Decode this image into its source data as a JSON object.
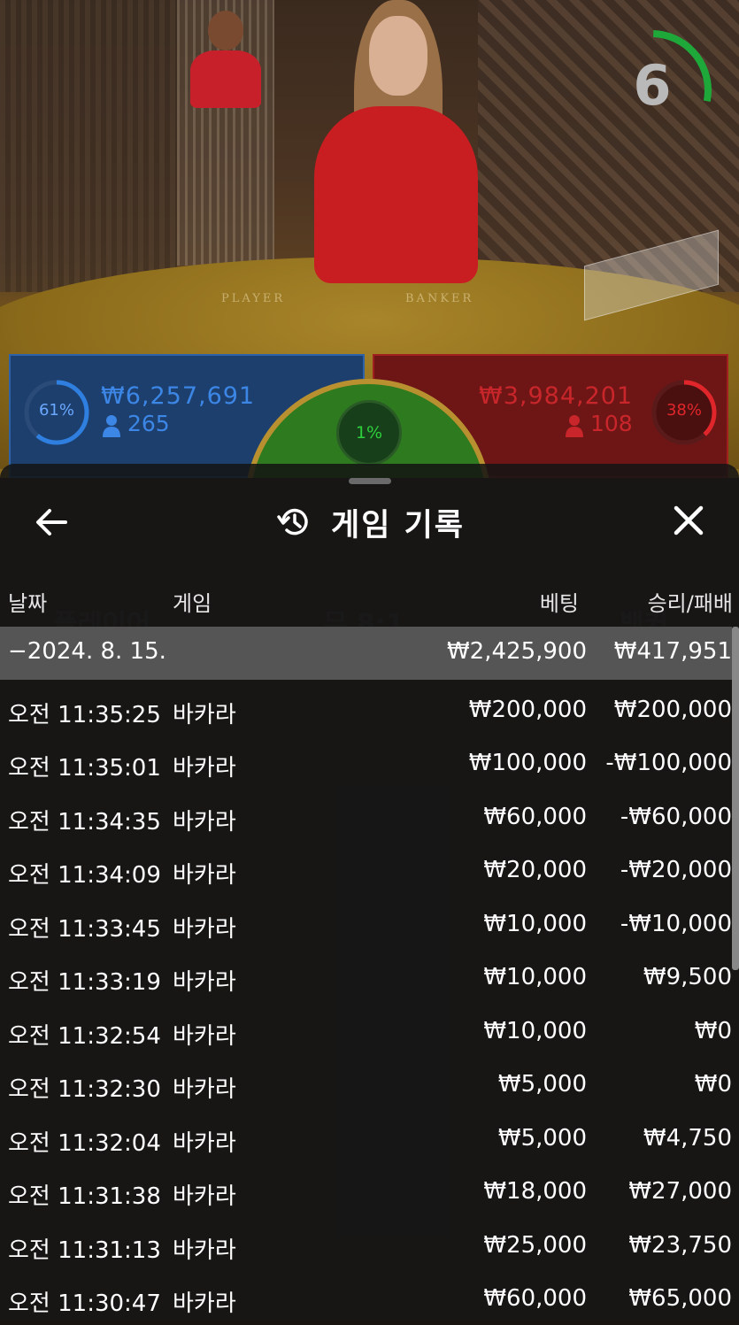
{
  "timer": {
    "count": "6",
    "progress": 0.55
  },
  "stats": {
    "player": {
      "percent": "61%",
      "amount": "₩6,257,691",
      "bettors": "265",
      "fraction": 0.61
    },
    "banker": {
      "percent": "38%",
      "amount": "₩3,984,201",
      "bettors": "108",
      "fraction": 0.38
    },
    "tie": {
      "percent": "1%"
    }
  },
  "table": {
    "player_label": "PLAYER",
    "banker_label": "BANKER"
  },
  "history": {
    "title": "게임 기록",
    "columns": {
      "date": "날짜",
      "game": "게임",
      "bet": "베팅",
      "result": "승리/패배"
    },
    "summary": {
      "date": "−2024. 8. 15.",
      "bet": "₩2,425,900",
      "result": "₩417,951"
    },
    "rows": [
      {
        "time": "오전 11:35:25",
        "game": "바카라",
        "bet": "₩200,000",
        "result": "₩200,000"
      },
      {
        "time": "오전 11:35:01",
        "game": "바카라",
        "bet": "₩100,000",
        "result": "-₩100,000"
      },
      {
        "time": "오전 11:34:35",
        "game": "바카라",
        "bet": "₩60,000",
        "result": "-₩60,000"
      },
      {
        "time": "오전 11:34:09",
        "game": "바카라",
        "bet": "₩20,000",
        "result": "-₩20,000"
      },
      {
        "time": "오전 11:33:45",
        "game": "바카라",
        "bet": "₩10,000",
        "result": "-₩10,000"
      },
      {
        "time": "오전 11:33:19",
        "game": "바카라",
        "bet": "₩10,000",
        "result": "₩9,500"
      },
      {
        "time": "오전 11:32:54",
        "game": "바카라",
        "bet": "₩10,000",
        "result": "₩0"
      },
      {
        "time": "오전 11:32:30",
        "game": "바카라",
        "bet": "₩5,000",
        "result": "₩0"
      },
      {
        "time": "오전 11:32:04",
        "game": "바카라",
        "bet": "₩5,000",
        "result": "₩4,750"
      },
      {
        "time": "오전 11:31:38",
        "game": "바카라",
        "bet": "₩18,000",
        "result": "₩27,000"
      },
      {
        "time": "오전 11:31:13",
        "game": "바카라",
        "bet": "₩25,000",
        "result": "₩23,750"
      },
      {
        "time": "오전 11:30:47",
        "game": "바카라",
        "bet": "₩60,000",
        "result": "₩65,000"
      }
    ]
  },
  "icons": {
    "back": "arrow-left-icon",
    "history": "history-clock-icon",
    "close": "close-icon",
    "bettors": "person-icon"
  },
  "colors": {
    "player": "#2e62a8",
    "banker": "#c0262a",
    "tie": "#2ecf3c",
    "timer": "#1fa83a"
  }
}
